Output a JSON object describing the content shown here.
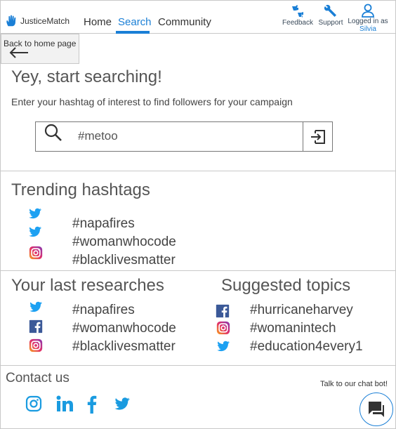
{
  "header": {
    "logo_text": "JusticeMatch",
    "nav": [
      {
        "label": "Home"
      },
      {
        "label": "Search"
      },
      {
        "label": "Community"
      }
    ],
    "feedback_label": "Feedback",
    "support_label": "Support",
    "logged_in_label": "Logged in as",
    "user_name": "Silvia"
  },
  "back_button": {
    "label": "Back to home page"
  },
  "search": {
    "title": "Yey, start searching!",
    "subtitle": "Enter your hashtag of interest to find followers for your campaign",
    "value": "#metoo"
  },
  "trending": {
    "title": "Trending hashtags",
    "items": [
      {
        "icon": "twitter-icon",
        "tag": ""
      },
      {
        "icon": "twitter-icon",
        "tag": "#napafires"
      },
      {
        "icon": "instagram-icon",
        "tag": "#womanwhocode"
      },
      {
        "icon": "",
        "tag": "#blacklivesmatter"
      }
    ]
  },
  "last_researches": {
    "title": "Your last researches",
    "items": [
      {
        "icon": "twitter-icon",
        "tag": "#napafires"
      },
      {
        "icon": "facebook-icon",
        "tag": "#womanwhocode"
      },
      {
        "icon": "instagram-icon",
        "tag": "#blacklivesmatter"
      }
    ]
  },
  "suggested": {
    "title": "Suggested topics",
    "items": [
      {
        "icon": "facebook-icon",
        "tag": "#hurricaneharvey"
      },
      {
        "icon": "instagram-icon",
        "tag": "#womanintech"
      },
      {
        "icon": "twitter-icon",
        "tag": "#education4every1"
      }
    ]
  },
  "contact": {
    "title": "Contact us",
    "socials": [
      "instagram-icon",
      "linkedin-icon",
      "facebook-icon",
      "twitter-icon"
    ],
    "chat_hint": "Talk to our chat bot!"
  },
  "colors": {
    "accent": "#1a7fd6",
    "twitter": "#1da1f2",
    "facebook": "#3b5998",
    "border": "#c8c8c8"
  }
}
